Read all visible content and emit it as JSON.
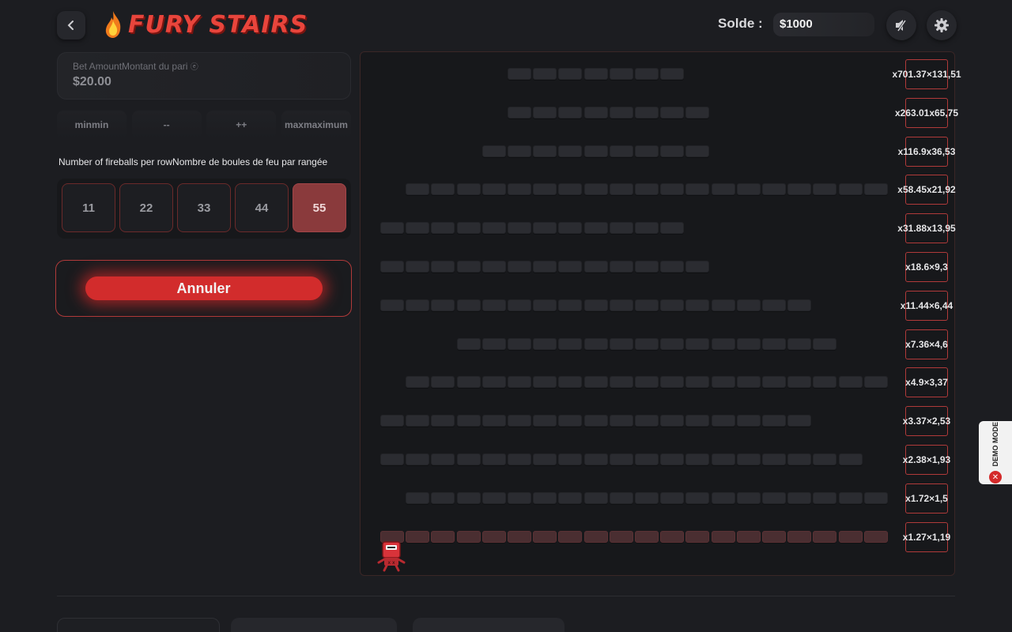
{
  "header": {
    "app_title": "FURY STAIRS",
    "balance_label": "Solde :",
    "balance_value": "$1000"
  },
  "icons": {
    "back": "chevron-left-icon",
    "logo": "flame-icon",
    "sound": "speaker-muted-icon",
    "settings": "gear-icon"
  },
  "bet": {
    "label": "Bet AmountMontant du pari",
    "value": "$20.00"
  },
  "quick_buttons": [
    "minmin",
    "--",
    "++",
    "maxmaximum"
  ],
  "fireballs": {
    "label": "Number of fireballs per rowNombre de boules de feu par rangée",
    "options": [
      "11",
      "22",
      "33",
      "44",
      "55"
    ],
    "selected_index": 4
  },
  "cancel_label": "Annuler",
  "multipliers": [
    "x701.37×131,51",
    "x263.01x65,75",
    "x116.9x36,53",
    "x58.45x21,92",
    "x31.88x13,95",
    "x18.6×9,3",
    "x11.44×6,44",
    "x7.36×4,6",
    "x4.9×3,37",
    "x3.37×2,53",
    "x2.38×1,93",
    "x1.72×1,5",
    "x1.27×1,19"
  ],
  "demo_mode_label": "DEMO MODE",
  "colors": {
    "accent_red": "#d22c2c",
    "background": "#1c1d21",
    "board": "#17181b"
  }
}
